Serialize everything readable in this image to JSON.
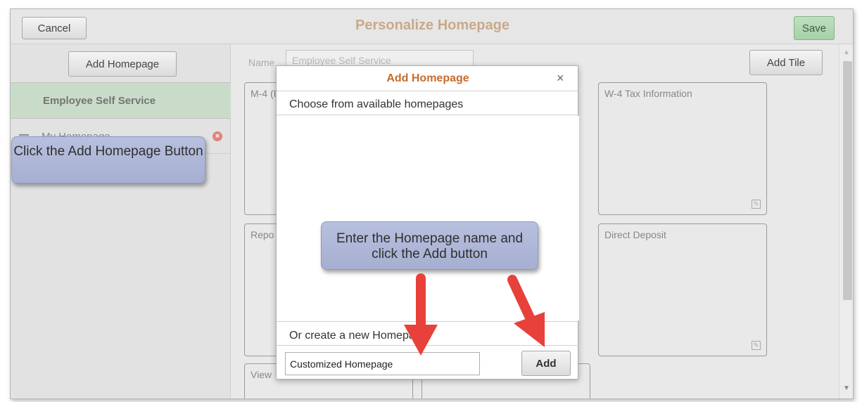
{
  "topbar": {
    "cancel_label": "Cancel",
    "title": "Personalize Homepage",
    "save_label": "Save"
  },
  "sidebar": {
    "add_homepage_label": "Add Homepage",
    "active_item": "Employee Self Service",
    "item_label": "My Homepage"
  },
  "main": {
    "name_label": "Name",
    "name_value": "Employee Self Service",
    "add_tile_label": "Add Tile",
    "tiles": [
      "M-4 (I",
      "W-4 Tax Information",
      "Repo",
      "Direct Deposit",
      "View"
    ]
  },
  "modal": {
    "title": "Add Homepage",
    "close_glyph": "×",
    "choose_label": "Choose from available homepages",
    "create_label": "Or create a new Homepage",
    "new_name_value": "Customized Homepage",
    "add_label": "Add"
  },
  "callouts": {
    "sidebar_hint": "Click the Add Homepage Button",
    "modal_hint": "Enter the Homepage name and click the Add button"
  },
  "colors": {
    "callout": "#aab3d4",
    "arrow": "#e8403a",
    "title": "#c76c2a",
    "save": "#a6d1a7"
  }
}
